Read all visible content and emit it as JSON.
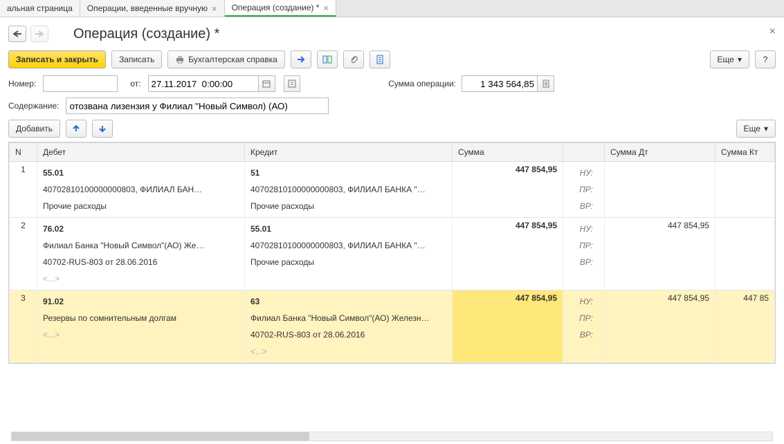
{
  "tabs": [
    {
      "label": "альная страница",
      "closable": false
    },
    {
      "label": "Операции, введенные вручную",
      "closable": true
    },
    {
      "label": "Операция (создание) *",
      "closable": true,
      "active": true
    }
  ],
  "title": "Операция (создание) *",
  "toolbar": {
    "save_close": "Записать и закрыть",
    "save": "Записать",
    "print_ref": "Бухгалтерская справка",
    "more": "Еще",
    "help": "?"
  },
  "fields": {
    "number_label": "Номер:",
    "number_value": "",
    "from_label": "от:",
    "date_value": "27.11.2017  0:00:00",
    "sum_label": "Сумма операции:",
    "sum_value": "1 343 564,85",
    "content_label": "Содержание:",
    "content_value": "отозвана лизензия у Филиал \"Новый Символ) (АО)"
  },
  "tablebar": {
    "add": "Добавить",
    "more": "Еще"
  },
  "columns": {
    "n": "N",
    "debit": "Дебет",
    "credit": "Кредит",
    "sum": "Сумма",
    "sum_dt": "Сумма Дт",
    "sum_kt": "Сумма Кт"
  },
  "tags": {
    "nu": "НУ:",
    "pr": "ПР:",
    "vr": "ВР:"
  },
  "rows": [
    {
      "n": "1",
      "debit": {
        "acct": "55.01",
        "l1": "40702810100000000803, ФИЛИАЛ БАН…",
        "l2": "Прочие расходы",
        "l3": ""
      },
      "credit": {
        "acct": "51",
        "l1": "40702810100000000803, ФИЛИАЛ БАНКА \"…",
        "l2": "Прочие расходы",
        "l3": ""
      },
      "sum": "447 854,95",
      "sum_dt": "",
      "sum_kt": ""
    },
    {
      "n": "2",
      "debit": {
        "acct": "76.02",
        "l1": "Филиал Банка \"Новый Символ\"(АО) Же…",
        "l2": "40702-RUS-803 от 28.06.2016",
        "l3": "<...>"
      },
      "credit": {
        "acct": "55.01",
        "l1": "40702810100000000803, ФИЛИАЛ БАНКА \"…",
        "l2": "Прочие расходы",
        "l3": ""
      },
      "sum": "447 854,95",
      "sum_dt": "447 854,95",
      "sum_kt": ""
    },
    {
      "n": "3",
      "selected": true,
      "debit": {
        "acct": "91.02",
        "l1": "Резервы по сомнительным долгам",
        "l2": "<...>",
        "l3": ""
      },
      "credit": {
        "acct": "63",
        "l1": "Филиал Банка \"Новый Символ\"(АО) Железн…",
        "l2": "40702-RUS-803 от 28.06.2016",
        "l3": "<...>"
      },
      "sum": "447 854,95",
      "sum_dt": "447 854,95",
      "sum_kt": "447 85"
    }
  ]
}
